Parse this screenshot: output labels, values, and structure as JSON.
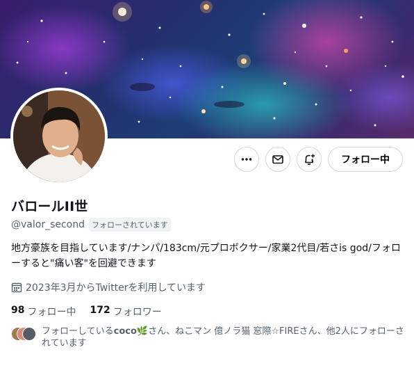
{
  "profile": {
    "display_name": "バロールII世",
    "handle": "@valor_second",
    "follows_you_badge": "フォローされています",
    "bio": "地方豪族を目指しています/ナンパ/183cm/元プロボクサー/家業2代目/若さis god/フォローすると\"痛い客\"を回避できます",
    "joined": "2023年3月からTwitterを利用しています"
  },
  "actions": {
    "more_icon": "more-horizontal-icon",
    "message_icon": "envelope-icon",
    "notify_icon": "bell-plus-icon",
    "follow_label": "フォロー中"
  },
  "stats": {
    "following_count": "98",
    "following_label": "フォロー中",
    "followers_count": "172",
    "followers_label": "フォロワー"
  },
  "mutuals": {
    "prefix": "フォローしている",
    "first_name": "coco",
    "rest": "🌿さん、ねこマン 億ノラ猫 窓際☆FIREさん、他2人にフォローされています"
  },
  "colors": {
    "text": "#0f1419",
    "muted": "#536471",
    "border": "#cfd9de",
    "badge_bg": "#eff3f4"
  }
}
